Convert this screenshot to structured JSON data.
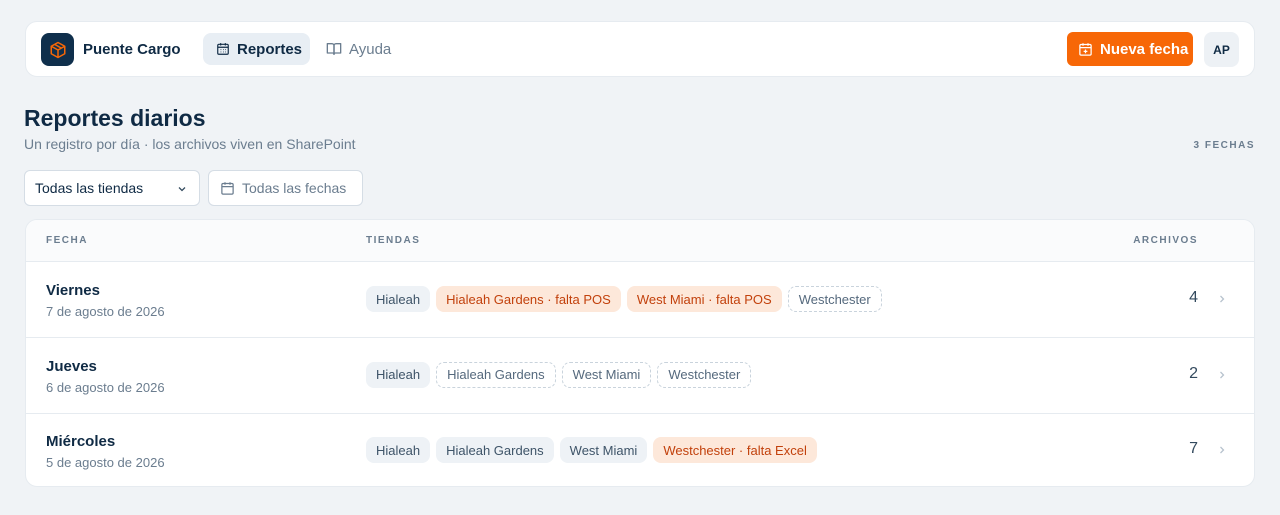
{
  "app": {
    "brand": "Puente Cargo",
    "nav": [
      {
        "label": "Reportes",
        "active": true,
        "icon": "calendar-icon"
      },
      {
        "label": "Ayuda",
        "active": false,
        "icon": "book-icon"
      }
    ],
    "new_button": "Nueva fecha",
    "avatar": "AP",
    "accent": "#f76707"
  },
  "page": {
    "title": "Reportes diarios",
    "subtitle": "Un registro por día · los archivos viven en SharePoint",
    "count": "3 FECHAS"
  },
  "filters": {
    "store": "Todas las tiendas",
    "date": "Todas las fechas"
  },
  "table": {
    "headers": {
      "fecha": "FECHA",
      "tiendas": "TIENDAS",
      "archivos": "ARCHIVOS"
    },
    "rows": [
      {
        "day": "Viernes",
        "date": "7 de agosto de 2026",
        "count": "4",
        "chips": [
          {
            "label": "Hialeah",
            "state": "ok"
          },
          {
            "label": "Hialeah Gardens · falta POS",
            "state": "warn"
          },
          {
            "label": "West Miami · falta POS",
            "state": "warn"
          },
          {
            "label": "Westchester",
            "state": "empty"
          }
        ]
      },
      {
        "day": "Jueves",
        "date": "6 de agosto de 2026",
        "count": "2",
        "chips": [
          {
            "label": "Hialeah",
            "state": "ok"
          },
          {
            "label": "Hialeah Gardens",
            "state": "empty"
          },
          {
            "label": "West Miami",
            "state": "empty"
          },
          {
            "label": "Westchester",
            "state": "empty"
          }
        ]
      },
      {
        "day": "Miércoles",
        "date": "5 de agosto de 2026",
        "count": "7",
        "chips": [
          {
            "label": "Hialeah",
            "state": "ok"
          },
          {
            "label": "Hialeah Gardens",
            "state": "ok"
          },
          {
            "label": "West Miami",
            "state": "ok"
          },
          {
            "label": "Westchester · falta Excel",
            "state": "warn"
          }
        ]
      }
    ]
  }
}
